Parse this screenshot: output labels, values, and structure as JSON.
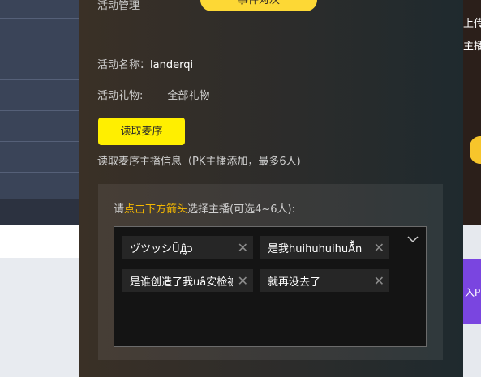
{
  "background": {
    "right_texts": [
      "上传",
      "主播"
    ],
    "purple_text": "入P"
  },
  "modal": {
    "tab_label": "活动管理",
    "tab_active": "事件对决",
    "activity_name_label": "活动名称：",
    "activity_name_value": "landerqi",
    "activity_gift_label": "活动礼物:",
    "activity_gift_value": "全部礼物",
    "read_button": "读取麦序",
    "read_hint": "读取麦序主播信息（PK主播添加，最多6人)",
    "prompt_prefix": "请",
    "prompt_highlight": "点击下方箭头",
    "prompt_suffix": "选择主播(可选4~6人):",
    "chips": [
      {
        "label": "ヅツッシŨд̯̑̑̑̑ↄ",
        "remove": "✕"
      },
      {
        "label": "是我huihuhuihuĀ̑̑̑̑n",
        "remove": "✕"
      },
      {
        "label": "是谁创造了我uа̑̑̑̑安检被没收了",
        "remove": "✕"
      },
      {
        "label": "就再没去了",
        "remove": "✕"
      }
    ]
  },
  "colors": {
    "accent_yellow": "#ffef00",
    "tab_yellow": "#fdd835",
    "highlight_orange": "#f5b800"
  }
}
